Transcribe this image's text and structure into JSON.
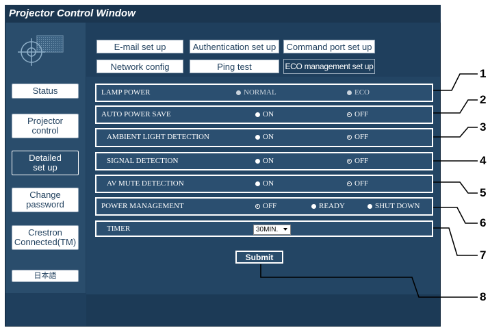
{
  "window": {
    "title": "Projector Control Window"
  },
  "sidebar": {
    "items": [
      {
        "label": "Status"
      },
      {
        "label": "Projector\ncontrol"
      },
      {
        "label": "Detailed\nset up"
      },
      {
        "label": "Change\npassword"
      },
      {
        "label": "Crestron\nConnected(TM)"
      },
      {
        "label": "日本語"
      }
    ],
    "active_index": 2
  },
  "tabs": {
    "row1": [
      "E-mail set up",
      "Authentication set up",
      "Command port set up"
    ],
    "row2": [
      "Network config",
      "Ping test",
      "ECO management set up"
    ],
    "active": "ECO management set up"
  },
  "settings": [
    {
      "label": "LAMP POWER",
      "options": [
        "NORMAL",
        "ECO"
      ]
    },
    {
      "label": "AUTO POWER SAVE",
      "options": [
        "ON",
        "OFF"
      ]
    },
    {
      "label": "AMBIENT LIGHT DETECTION",
      "options": [
        "ON",
        "OFF"
      ]
    },
    {
      "label": "SIGNAL DETECTION",
      "options": [
        "ON",
        "OFF"
      ]
    },
    {
      "label": "AV MUTE DETECTION",
      "options": [
        "ON",
        "OFF"
      ]
    },
    {
      "label": "POWER MANAGEMENT",
      "options": [
        "OFF",
        "READY",
        "SHUT DOWN"
      ]
    },
    {
      "label": "TIMER",
      "value": "30MIN."
    }
  ],
  "submit_label": "Submit",
  "callouts": [
    "1",
    "2",
    "3",
    "4",
    "5",
    "6",
    "7",
    "8"
  ],
  "colors": {
    "window_bg": "#1f3f5d",
    "sidebar_bg": "#2a4d6c",
    "text": "#ffffff"
  }
}
